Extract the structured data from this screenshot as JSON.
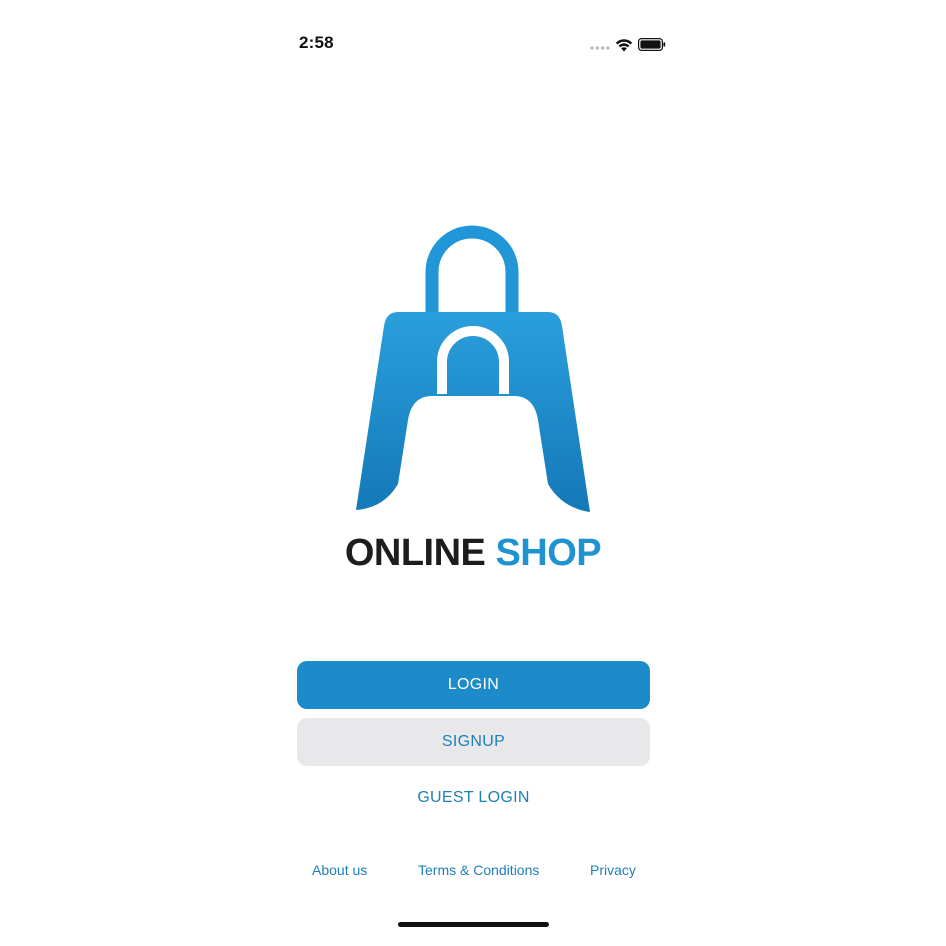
{
  "status_bar": {
    "time": "2:58",
    "signal_icon": "cellular-signal-icon",
    "wifi_icon": "wifi-icon",
    "battery_icon": "battery-icon"
  },
  "logo": {
    "icon": "shopping-bag-logo-icon",
    "brand_word_1": "ONLINE",
    "brand_word_2": "SHOP"
  },
  "actions": {
    "login_label": "LOGIN",
    "signup_label": "SIGNUP",
    "guest_login_label": "GUEST LOGIN"
  },
  "footer": {
    "about_label": "About us",
    "terms_label": "Terms & Conditions",
    "privacy_label": "Privacy"
  },
  "colors": {
    "primary": "#1d8ac9",
    "brand_blue": "#1f93d1",
    "secondary_button_bg": "#e8e8ea",
    "link": "#1d7fb8",
    "text_dark": "#1d1d1f"
  }
}
